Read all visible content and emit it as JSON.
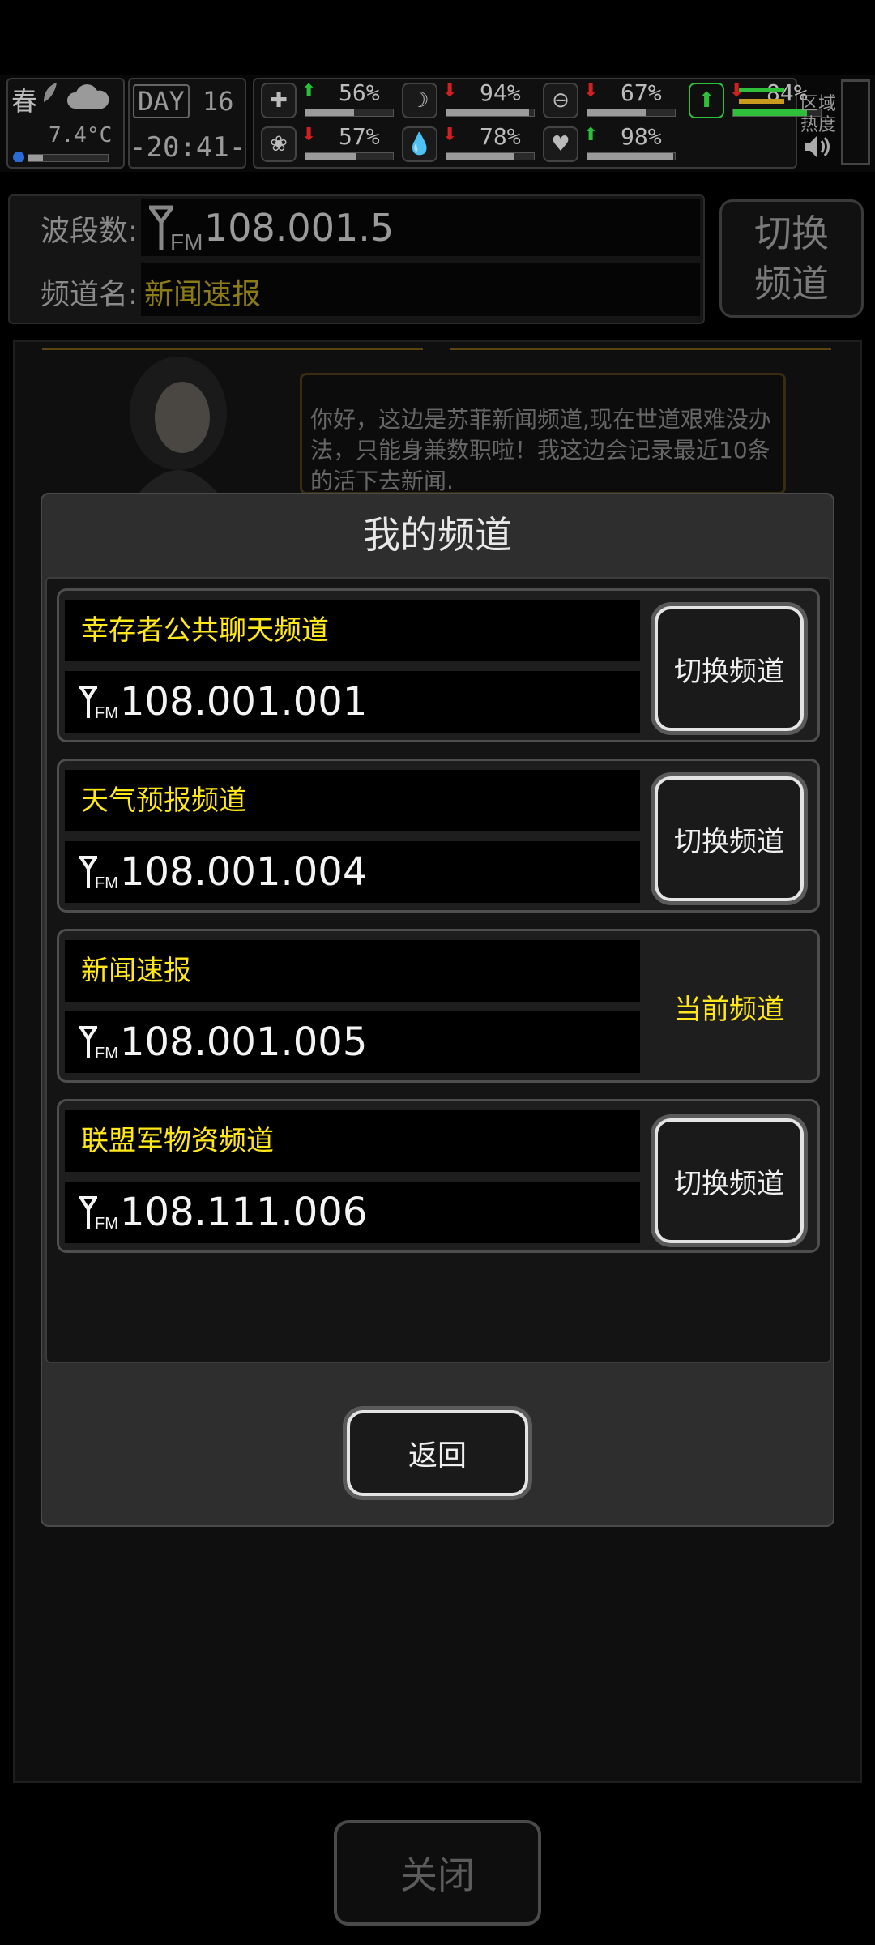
{
  "status": {
    "season": "春",
    "day_label": "DAY",
    "day_value": "16",
    "temperature": "7.4°C",
    "time": "-20:41-",
    "region_label_1": "区域",
    "region_label_2": "热度",
    "stats": [
      {
        "icon": "medkit-icon",
        "trend": "up",
        "value": "56%",
        "level": 0.56
      },
      {
        "icon": "stomach-icon",
        "trend": "down",
        "value": "94%",
        "level": 0.94
      },
      {
        "icon": "bladder-icon",
        "trend": "down",
        "value": "67%",
        "level": 0.67
      },
      {
        "icon": "brain-icon",
        "trend": "down",
        "value": "57%",
        "level": 0.57
      },
      {
        "icon": "water-drop-icon",
        "trend": "down",
        "value": "78%",
        "level": 0.78
      },
      {
        "icon": "heart-icon",
        "trend": "up",
        "value": "98%",
        "level": 0.98
      },
      {
        "icon": "stamina-icon",
        "trend": "down",
        "value": "84%",
        "level": 0.84
      }
    ]
  },
  "radio": {
    "band_label": "波段数:",
    "band_value": "108.001.5",
    "channel_label": "频道名:",
    "channel_value": "新闻速报",
    "switch_label_1": "切换",
    "switch_label_2": "频道",
    "speech_text": "你好，这边是苏菲新闻频道,现在世道艰难没办法，只能身兼数职啦！我这边会记录最近10条的活下去新闻."
  },
  "modal": {
    "title": "我的频道",
    "channels": [
      {
        "name": "幸存者公共聊天频道",
        "freq": "108.001.001",
        "action": "切换频道",
        "current": false
      },
      {
        "name": "天气预报频道",
        "freq": "108.001.004",
        "action": "切换频道",
        "current": false
      },
      {
        "name": "新闻速报",
        "freq": "108.001.005",
        "action": "当前频道",
        "current": true
      },
      {
        "name": "联盟军物资频道",
        "freq": "108.111.006",
        "action": "切换频道",
        "current": false
      }
    ],
    "back_label": "返回"
  },
  "footer": {
    "close_label": "关闭"
  },
  "colors": {
    "accent_yellow": "#ffe71a",
    "background": "#000000",
    "panel": "#2e2e2e"
  }
}
